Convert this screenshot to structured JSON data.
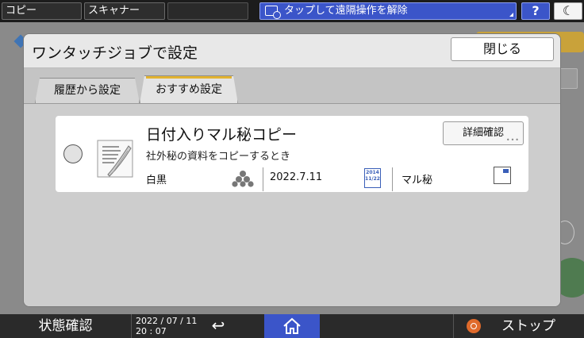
{
  "topbar": {
    "copy_label": "コピー",
    "scanner_label": "スキャナー",
    "remote_label": "タップして遠隔操作を解除",
    "help_label": "?",
    "sleep_label": "☾"
  },
  "dialog": {
    "title": "ワンタッチジョブで設定",
    "close_label": "閉じる",
    "tabs": [
      {
        "label": "履歴から設定",
        "active": false
      },
      {
        "label": "おすすめ設定",
        "active": true
      }
    ],
    "job": {
      "title": "日付入りマル秘コピー",
      "description": "社外秘の資料をコピーするとき",
      "detail_label": "詳細確認",
      "color_mode": "白黒",
      "date": "2022.7.11",
      "calendar_year": "2014",
      "calendar_date": "11/22",
      "stamp": "マル秘",
      "selected": false
    }
  },
  "bottombar": {
    "status_label": "状態確認",
    "date": "2022 / 07 / 11",
    "time": "20 : 07",
    "back_label": "↩",
    "stop_label": "ストップ"
  },
  "colors": {
    "accent_blue": "#3b55c9",
    "tab_highlight": "#e2b331",
    "stop_orange": "#e06a2b"
  }
}
